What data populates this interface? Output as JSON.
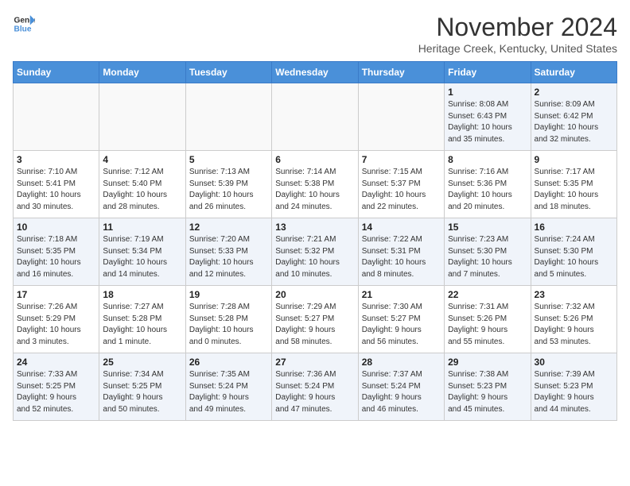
{
  "logo": {
    "line1": "General",
    "line2": "Blue"
  },
  "header": {
    "title": "November 2024",
    "subtitle": "Heritage Creek, Kentucky, United States"
  },
  "weekdays": [
    "Sunday",
    "Monday",
    "Tuesday",
    "Wednesday",
    "Thursday",
    "Friday",
    "Saturday"
  ],
  "weeks": [
    [
      {
        "day": "",
        "info": "",
        "empty": true
      },
      {
        "day": "",
        "info": "",
        "empty": true
      },
      {
        "day": "",
        "info": "",
        "empty": true
      },
      {
        "day": "",
        "info": "",
        "empty": true
      },
      {
        "day": "",
        "info": "",
        "empty": true
      },
      {
        "day": "1",
        "info": "Sunrise: 8:08 AM\nSunset: 6:43 PM\nDaylight: 10 hours\nand 35 minutes."
      },
      {
        "day": "2",
        "info": "Sunrise: 8:09 AM\nSunset: 6:42 PM\nDaylight: 10 hours\nand 32 minutes."
      }
    ],
    [
      {
        "day": "3",
        "info": "Sunrise: 7:10 AM\nSunset: 5:41 PM\nDaylight: 10 hours\nand 30 minutes."
      },
      {
        "day": "4",
        "info": "Sunrise: 7:12 AM\nSunset: 5:40 PM\nDaylight: 10 hours\nand 28 minutes."
      },
      {
        "day": "5",
        "info": "Sunrise: 7:13 AM\nSunset: 5:39 PM\nDaylight: 10 hours\nand 26 minutes."
      },
      {
        "day": "6",
        "info": "Sunrise: 7:14 AM\nSunset: 5:38 PM\nDaylight: 10 hours\nand 24 minutes."
      },
      {
        "day": "7",
        "info": "Sunrise: 7:15 AM\nSunset: 5:37 PM\nDaylight: 10 hours\nand 22 minutes."
      },
      {
        "day": "8",
        "info": "Sunrise: 7:16 AM\nSunset: 5:36 PM\nDaylight: 10 hours\nand 20 minutes."
      },
      {
        "day": "9",
        "info": "Sunrise: 7:17 AM\nSunset: 5:35 PM\nDaylight: 10 hours\nand 18 minutes."
      }
    ],
    [
      {
        "day": "10",
        "info": "Sunrise: 7:18 AM\nSunset: 5:35 PM\nDaylight: 10 hours\nand 16 minutes."
      },
      {
        "day": "11",
        "info": "Sunrise: 7:19 AM\nSunset: 5:34 PM\nDaylight: 10 hours\nand 14 minutes."
      },
      {
        "day": "12",
        "info": "Sunrise: 7:20 AM\nSunset: 5:33 PM\nDaylight: 10 hours\nand 12 minutes."
      },
      {
        "day": "13",
        "info": "Sunrise: 7:21 AM\nSunset: 5:32 PM\nDaylight: 10 hours\nand 10 minutes."
      },
      {
        "day": "14",
        "info": "Sunrise: 7:22 AM\nSunset: 5:31 PM\nDaylight: 10 hours\nand 8 minutes."
      },
      {
        "day": "15",
        "info": "Sunrise: 7:23 AM\nSunset: 5:30 PM\nDaylight: 10 hours\nand 7 minutes."
      },
      {
        "day": "16",
        "info": "Sunrise: 7:24 AM\nSunset: 5:30 PM\nDaylight: 10 hours\nand 5 minutes."
      }
    ],
    [
      {
        "day": "17",
        "info": "Sunrise: 7:26 AM\nSunset: 5:29 PM\nDaylight: 10 hours\nand 3 minutes."
      },
      {
        "day": "18",
        "info": "Sunrise: 7:27 AM\nSunset: 5:28 PM\nDaylight: 10 hours\nand 1 minute."
      },
      {
        "day": "19",
        "info": "Sunrise: 7:28 AM\nSunset: 5:28 PM\nDaylight: 10 hours\nand 0 minutes."
      },
      {
        "day": "20",
        "info": "Sunrise: 7:29 AM\nSunset: 5:27 PM\nDaylight: 9 hours\nand 58 minutes."
      },
      {
        "day": "21",
        "info": "Sunrise: 7:30 AM\nSunset: 5:27 PM\nDaylight: 9 hours\nand 56 minutes."
      },
      {
        "day": "22",
        "info": "Sunrise: 7:31 AM\nSunset: 5:26 PM\nDaylight: 9 hours\nand 55 minutes."
      },
      {
        "day": "23",
        "info": "Sunrise: 7:32 AM\nSunset: 5:26 PM\nDaylight: 9 hours\nand 53 minutes."
      }
    ],
    [
      {
        "day": "24",
        "info": "Sunrise: 7:33 AM\nSunset: 5:25 PM\nDaylight: 9 hours\nand 52 minutes."
      },
      {
        "day": "25",
        "info": "Sunrise: 7:34 AM\nSunset: 5:25 PM\nDaylight: 9 hours\nand 50 minutes."
      },
      {
        "day": "26",
        "info": "Sunrise: 7:35 AM\nSunset: 5:24 PM\nDaylight: 9 hours\nand 49 minutes."
      },
      {
        "day": "27",
        "info": "Sunrise: 7:36 AM\nSunset: 5:24 PM\nDaylight: 9 hours\nand 47 minutes."
      },
      {
        "day": "28",
        "info": "Sunrise: 7:37 AM\nSunset: 5:24 PM\nDaylight: 9 hours\nand 46 minutes."
      },
      {
        "day": "29",
        "info": "Sunrise: 7:38 AM\nSunset: 5:23 PM\nDaylight: 9 hours\nand 45 minutes."
      },
      {
        "day": "30",
        "info": "Sunrise: 7:39 AM\nSunset: 5:23 PM\nDaylight: 9 hours\nand 44 minutes."
      }
    ]
  ]
}
